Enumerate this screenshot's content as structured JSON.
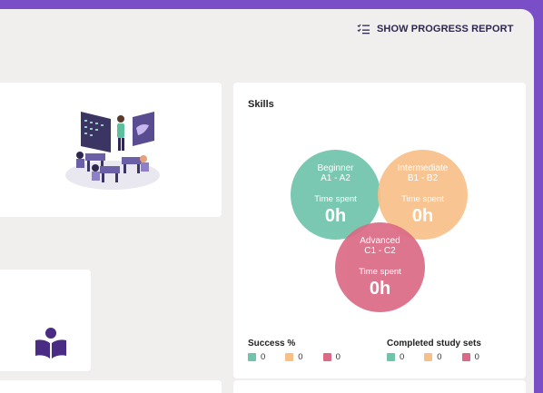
{
  "header": {
    "progress_report_label": "SHOW PROGRESS REPORT",
    "progress_report_icon": "list-check-icon"
  },
  "skills": {
    "title": "Skills",
    "levels": [
      {
        "name": "Beginner",
        "range": "A1 - A2",
        "time_label": "Time spent",
        "time_value": "0h",
        "color": "#6fc4ab"
      },
      {
        "name": "Intermediate",
        "range": "B1 - B2",
        "time_label": "Time spent",
        "time_value": "0h",
        "color": "#f8c089"
      },
      {
        "name": "Advanced",
        "range": "C1 - C2",
        "time_label": "Time spent",
        "time_value": "0h",
        "color": "#dc6a86"
      }
    ],
    "success": {
      "title": "Success %",
      "values": [
        "0",
        "0",
        "0"
      ]
    },
    "completed": {
      "title": "Completed study sets",
      "values": [
        "0",
        "0",
        "0"
      ]
    }
  },
  "icons": {
    "classroom": "classroom-illustration",
    "reader": "reader-book-icon"
  },
  "colors": {
    "background": "#7a4ec7",
    "panel": "#f1efed",
    "beginner": "#6fc4ab",
    "intermediate": "#f8c089",
    "advanced": "#dc6a86",
    "accent": "#4a2c84"
  }
}
